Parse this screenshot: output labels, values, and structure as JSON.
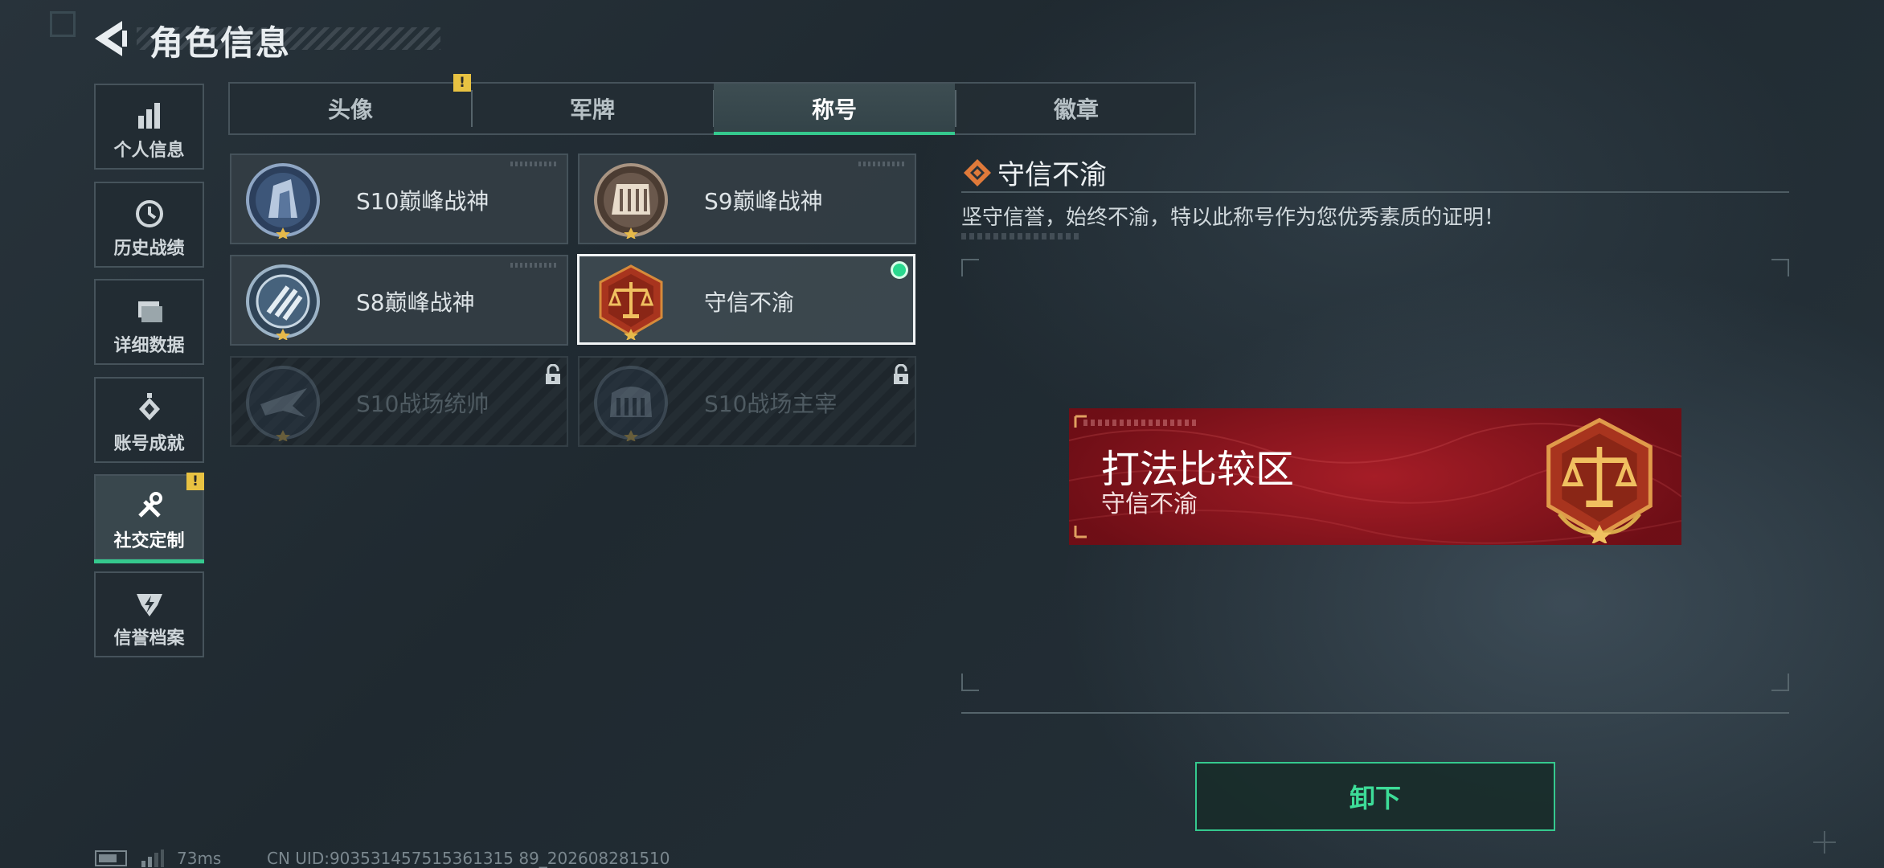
{
  "header": {
    "title": "角色信息",
    "back_icon": "back-arrow-icon"
  },
  "sidebar": {
    "items": [
      {
        "label": "个人信息",
        "icon": "bar-chart-icon",
        "active": false
      },
      {
        "label": "历史战绩",
        "icon": "history-clock-icon",
        "active": false
      },
      {
        "label": "详细数据",
        "icon": "folder-icon",
        "active": false
      },
      {
        "label": "账号成就",
        "icon": "medal-icon",
        "active": false
      },
      {
        "label": "社交定制",
        "icon": "tools-icon",
        "active": true,
        "alert": "!"
      },
      {
        "label": "信誉档案",
        "icon": "shield-bolt-icon",
        "active": false
      }
    ]
  },
  "tabs": [
    {
      "label": "头像",
      "active": false,
      "alert": "!"
    },
    {
      "label": "军牌",
      "active": false
    },
    {
      "label": "称号",
      "active": true
    },
    {
      "label": "徽章",
      "active": false
    }
  ],
  "titles": [
    {
      "name": "S10巅峰战神",
      "locked": false,
      "selected": false,
      "equipped": false
    },
    {
      "name": "S9巅峰战神",
      "locked": false,
      "selected": false,
      "equipped": false
    },
    {
      "name": "S8巅峰战神",
      "locked": false,
      "selected": false,
      "equipped": false
    },
    {
      "name": "守信不渝",
      "locked": false,
      "selected": true,
      "equipped": true
    },
    {
      "name": "S10战场统帅",
      "locked": true,
      "selected": false,
      "equipped": false
    },
    {
      "name": "S10战场主宰",
      "locked": true,
      "selected": false,
      "equipped": false
    }
  ],
  "detail": {
    "title": "守信不渝",
    "description": "坚守信誉，始终不渝，特以此称号作为您优秀素质的证明！",
    "preview": {
      "banner_title": "打法比较区",
      "banner_subtitle": "守信不渝"
    },
    "action_label": "卸下"
  },
  "status_bar": {
    "ping": "73ms",
    "uid": "CN UID:903531457515361315 89_202608281510"
  },
  "colors": {
    "accent": "#35c98e",
    "alert": "#e8c242",
    "banner_red": "#8e1a22"
  }
}
